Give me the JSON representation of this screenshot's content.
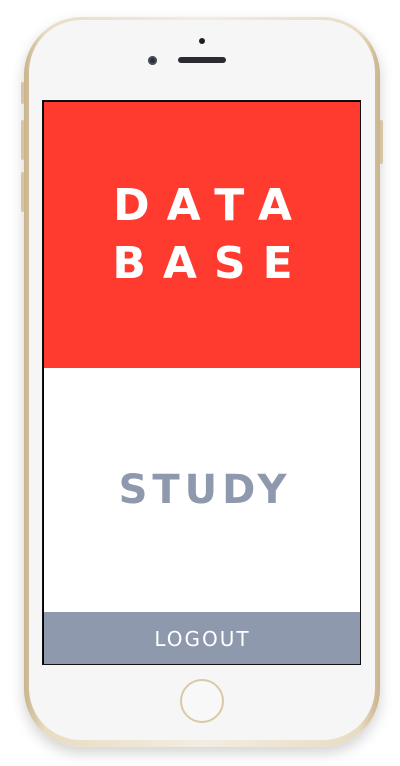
{
  "screen": {
    "database_tile": {
      "lines": [
        "DATA",
        "BASE"
      ],
      "color": "#ff3b30"
    },
    "study_tile": {
      "label": "STUDY",
      "text_color": "#8e99ad"
    },
    "logout": {
      "label": "LOGOUT",
      "color": "#8e99ad"
    }
  },
  "device": {
    "frame_color": "#e8dcc3"
  }
}
